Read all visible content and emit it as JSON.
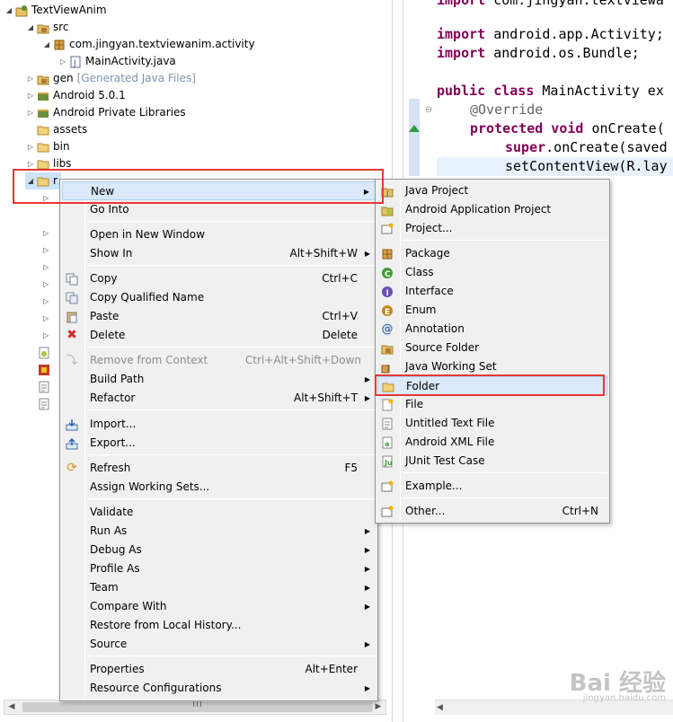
{
  "explorer": {
    "rows": [
      {
        "label": "TextViewAnim",
        "extra": ""
      },
      {
        "label": "src",
        "extra": ""
      },
      {
        "label": "com.jingyan.textviewanim.activity",
        "extra": ""
      },
      {
        "label": "MainActivity.java",
        "extra": ""
      },
      {
        "label": "gen",
        "extra": "[Generated Java Files]"
      },
      {
        "label": "Android 5.0.1",
        "extra": ""
      },
      {
        "label": "Android Private Libraries",
        "extra": ""
      },
      {
        "label": "assets",
        "extra": ""
      },
      {
        "label": "bin",
        "extra": ""
      },
      {
        "label": "libs",
        "extra": ""
      },
      {
        "label": "r",
        "extra": ""
      }
    ],
    "scroll_grip": "III"
  },
  "editor": {
    "lines": [
      {
        "kw": "import",
        "rest": " com.jingyan.textviewa"
      },
      {
        "kw": "import",
        "rest": " android.app.Activity;"
      },
      {
        "kw": "import",
        "rest": " android.os.Bundle;"
      },
      {
        "kw": "public class",
        "rest": " MainActivity ex"
      },
      {
        "kw": "",
        "rest": "@Override"
      },
      {
        "kw": "protected void",
        "rest": " onCreate("
      },
      {
        "kw": "super",
        "rest": ".onCreate(saved"
      },
      {
        "kw": "",
        "rest": "setContentView(R.lay"
      }
    ]
  },
  "context_menu": {
    "items": [
      {
        "label": "New",
        "shortcut": "",
        "submenu": true,
        "icon": "",
        "disabled": false
      },
      {
        "label": "Go Into",
        "shortcut": "",
        "submenu": false,
        "icon": "",
        "disabled": false
      },
      {
        "label": "Open in New Window",
        "shortcut": "",
        "submenu": false,
        "icon": "",
        "disabled": false
      },
      {
        "label": "Show In",
        "shortcut": "Alt+Shift+W",
        "submenu": true,
        "icon": "",
        "disabled": false
      },
      {
        "label": "Copy",
        "shortcut": "Ctrl+C",
        "submenu": false,
        "icon": "copy-icon",
        "disabled": false
      },
      {
        "label": "Copy Qualified Name",
        "shortcut": "",
        "submenu": false,
        "icon": "copy-qualified-icon",
        "disabled": false
      },
      {
        "label": "Paste",
        "shortcut": "Ctrl+V",
        "submenu": false,
        "icon": "paste-icon",
        "disabled": false
      },
      {
        "label": "Delete",
        "shortcut": "Delete",
        "submenu": false,
        "icon": "delete-icon",
        "disabled": false
      },
      {
        "label": "Remove from Context",
        "shortcut": "Ctrl+Alt+Shift+Down",
        "submenu": false,
        "icon": "remove-context-icon",
        "disabled": true
      },
      {
        "label": "Build Path",
        "shortcut": "",
        "submenu": true,
        "icon": "",
        "disabled": false
      },
      {
        "label": "Refactor",
        "shortcut": "Alt+Shift+T",
        "submenu": true,
        "icon": "",
        "disabled": false
      },
      {
        "label": "Import...",
        "shortcut": "",
        "submenu": false,
        "icon": "import-icon",
        "disabled": false
      },
      {
        "label": "Export...",
        "shortcut": "",
        "submenu": false,
        "icon": "export-icon",
        "disabled": false
      },
      {
        "label": "Refresh",
        "shortcut": "F5",
        "submenu": false,
        "icon": "refresh-icon",
        "disabled": false
      },
      {
        "label": "Assign Working Sets...",
        "shortcut": "",
        "submenu": false,
        "icon": "",
        "disabled": false
      },
      {
        "label": "Validate",
        "shortcut": "",
        "submenu": false,
        "icon": "",
        "disabled": false
      },
      {
        "label": "Run As",
        "shortcut": "",
        "submenu": true,
        "icon": "",
        "disabled": false
      },
      {
        "label": "Debug As",
        "shortcut": "",
        "submenu": true,
        "icon": "",
        "disabled": false
      },
      {
        "label": "Profile As",
        "shortcut": "",
        "submenu": true,
        "icon": "",
        "disabled": false
      },
      {
        "label": "Team",
        "shortcut": "",
        "submenu": true,
        "icon": "",
        "disabled": false
      },
      {
        "label": "Compare With",
        "shortcut": "",
        "submenu": true,
        "icon": "",
        "disabled": false
      },
      {
        "label": "Restore from Local History...",
        "shortcut": "",
        "submenu": false,
        "icon": "",
        "disabled": false
      },
      {
        "label": "Source",
        "shortcut": "",
        "submenu": true,
        "icon": "",
        "disabled": false
      },
      {
        "label": "Properties",
        "shortcut": "Alt+Enter",
        "submenu": false,
        "icon": "",
        "disabled": false
      },
      {
        "label": "Resource Configurations",
        "shortcut": "",
        "submenu": true,
        "icon": "",
        "disabled": false
      }
    ]
  },
  "submenu": {
    "items": [
      {
        "label": "Java Project",
        "shortcut": "",
        "icon": "java-project-icon"
      },
      {
        "label": "Android Application Project",
        "shortcut": "",
        "icon": "android-project-icon"
      },
      {
        "label": "Project...",
        "shortcut": "",
        "icon": "project-icon"
      },
      {
        "label": "Package",
        "shortcut": "",
        "icon": "package-icon"
      },
      {
        "label": "Class",
        "shortcut": "",
        "icon": "class-icon"
      },
      {
        "label": "Interface",
        "shortcut": "",
        "icon": "interface-icon"
      },
      {
        "label": "Enum",
        "shortcut": "",
        "icon": "enum-icon"
      },
      {
        "label": "Annotation",
        "shortcut": "",
        "icon": "annotation-icon"
      },
      {
        "label": "Source Folder",
        "shortcut": "",
        "icon": "source-folder-icon"
      },
      {
        "label": "Java Working Set",
        "shortcut": "",
        "icon": "working-set-icon"
      },
      {
        "label": "Folder",
        "shortcut": "",
        "icon": "folder-icon"
      },
      {
        "label": "File",
        "shortcut": "",
        "icon": "file-icon"
      },
      {
        "label": "Untitled Text File",
        "shortcut": "",
        "icon": "text-file-icon"
      },
      {
        "label": "Android XML File",
        "shortcut": "",
        "icon": "xml-file-icon"
      },
      {
        "label": "JUnit Test Case",
        "shortcut": "",
        "icon": "junit-icon"
      },
      {
        "label": "Example...",
        "shortcut": "",
        "icon": "example-icon"
      },
      {
        "label": "Other...",
        "shortcut": "Ctrl+N",
        "icon": "other-icon"
      }
    ]
  },
  "colors": {
    "highlight_box": "#e53935",
    "keyword": "#7f0055",
    "menu_bg": "#f0f0f0",
    "hover_bg": "#dbe9fa"
  },
  "watermark": {
    "logo": "Bai 经验",
    "url": "jingyan.baidu.com"
  }
}
